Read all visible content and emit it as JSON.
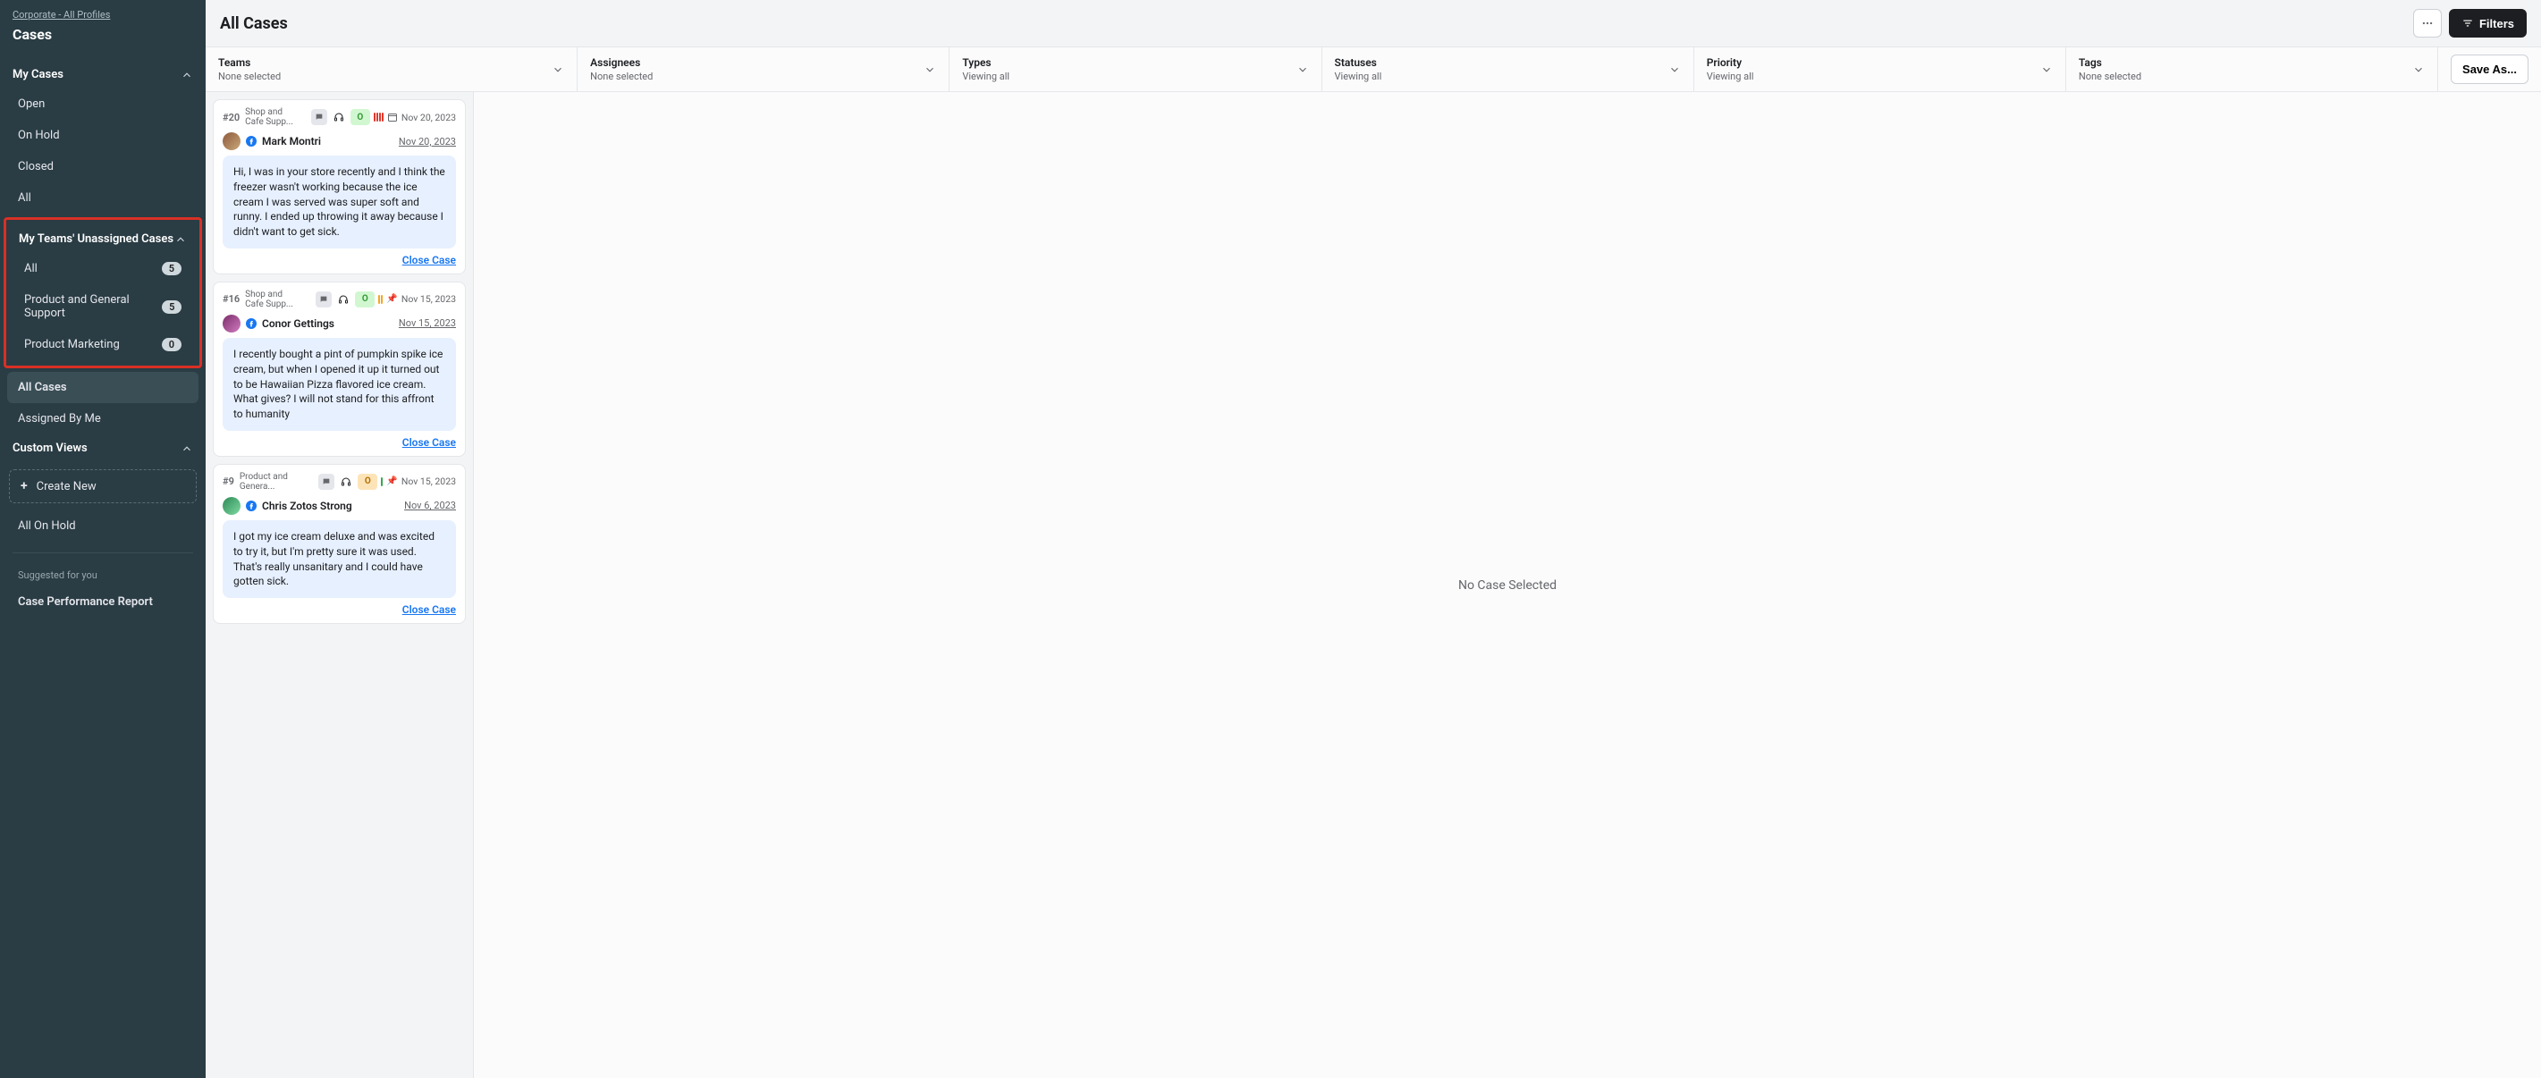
{
  "breadcrumb": "Corporate - All Profiles",
  "sidebarTitle": "Cases",
  "nav": {
    "myCases": {
      "label": "My Cases",
      "items": [
        {
          "label": "Open"
        },
        {
          "label": "On Hold"
        },
        {
          "label": "Closed"
        },
        {
          "label": "All"
        }
      ]
    },
    "unassigned": {
      "label": "My Teams' Unassigned Cases",
      "items": [
        {
          "label": "All",
          "count": "5"
        },
        {
          "label": "Product and General Support",
          "count": "5"
        },
        {
          "label": "Product Marketing",
          "count": "0"
        }
      ]
    },
    "allCases": "All Cases",
    "assignedByMe": "Assigned By Me",
    "customViews": {
      "label": "Custom Views",
      "createNew": "Create New",
      "items": [
        {
          "label": "All On Hold"
        }
      ]
    },
    "suggestedLabel": "Suggested for you",
    "suggestedItem": "Case Performance Report"
  },
  "header": {
    "title": "All Cases",
    "filtersLabel": "Filters"
  },
  "filters": [
    {
      "label": "Teams",
      "sub": "None selected"
    },
    {
      "label": "Assignees",
      "sub": "None selected"
    },
    {
      "label": "Types",
      "sub": "Viewing all"
    },
    {
      "label": "Statuses",
      "sub": "Viewing all"
    },
    {
      "label": "Priority",
      "sub": "Viewing all"
    },
    {
      "label": "Tags",
      "sub": "None selected"
    }
  ],
  "saveAs": "Save As...",
  "cases": [
    {
      "id": "#20",
      "team": "Shop and Cafe Supp...",
      "statusGlyph": "O",
      "statusClass": "dot-o",
      "bars": [
        "r",
        "r",
        "r",
        "r"
      ],
      "pin": false,
      "dateTop": "Nov 20, 2023",
      "avatarColor": "linear-gradient(135deg,#8e5a3b,#c9a77a)",
      "author": "Mark Montri",
      "authorDate": "Nov 20, 2023",
      "msg": "Hi, I was in your store recently and I think the freezer wasn't working because the ice cream I was served was super soft and runny. I ended up throwing it away because I didn't want to get sick.",
      "closeLabel": "Close Case"
    },
    {
      "id": "#16",
      "team": "Shop and Cafe Supp...",
      "statusGlyph": "O",
      "statusClass": "dot-o",
      "bars": [
        "o",
        "o"
      ],
      "pin": true,
      "dateTop": "Nov 15, 2023",
      "avatarColor": "linear-gradient(135deg,#7b2d6a,#d07bbf)",
      "author": "Conor Gettings",
      "authorDate": "Nov 15, 2023",
      "msg": "I recently bought a pint of pumpkin spike ice cream, but when I opened it up it turned out to be Hawaiian Pizza flavored ice cream. What gives? I will not stand for this affront to humanity",
      "closeLabel": "Close Case"
    },
    {
      "id": "#9",
      "team": "Product and Genera...",
      "statusGlyph": "O",
      "statusClass": "dot-warn",
      "bars": [
        "g"
      ],
      "pin": true,
      "dateTop": "Nov 15, 2023",
      "avatarColor": "linear-gradient(135deg,#2e8b57,#7ed9a0)",
      "author": "Chris Zotos Strong",
      "authorDate": "Nov 6, 2023",
      "msg": "I got my ice cream deluxe and was excited to try it, but I'm pretty sure it was used. That's really unsanitary and I could have gotten sick.",
      "closeLabel": "Close Case"
    }
  ],
  "detailEmpty": "No Case Selected"
}
